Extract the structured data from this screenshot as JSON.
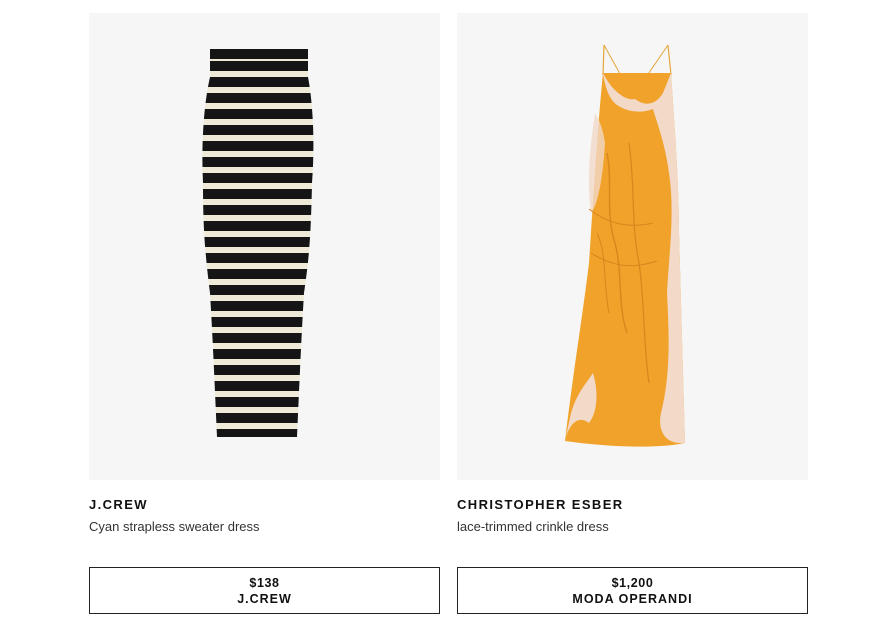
{
  "products": [
    {
      "brand": "J.CREW",
      "name": "Cyan strapless sweater dress",
      "price": "$138",
      "retailer": "J.CREW",
      "colors": {
        "stripe_dark": "#151515",
        "stripe_light": "#efe9d8"
      }
    },
    {
      "brand": "CHRISTOPHER ESBER",
      "name": "lace-trimmed crinkle dress",
      "price": "$1,200",
      "retailer": "MODA OPERANDI",
      "colors": {
        "main": "#f0a22a",
        "lace": "#f3d9c8"
      }
    }
  ],
  "colors": {
    "image_bg": "#f6f6f6",
    "border": "#222222"
  }
}
